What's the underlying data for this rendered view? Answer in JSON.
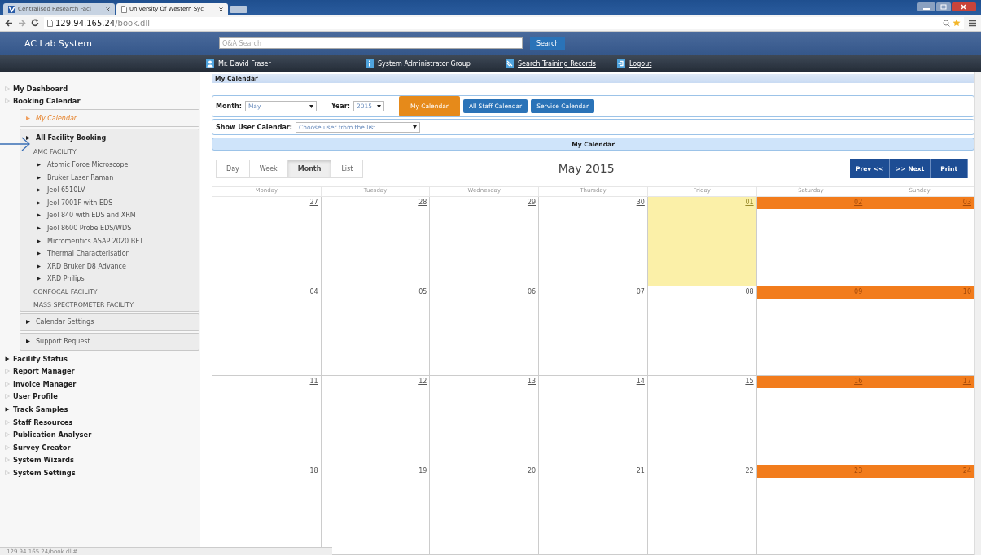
{
  "browser": {
    "tabs": [
      {
        "title": "Centralised Research Faci",
        "selected": false
      },
      {
        "title": "University Of Western Syc",
        "selected": true
      }
    ],
    "address": {
      "host": "129.94.165.24",
      "path": "/book.dll"
    }
  },
  "app": {
    "title": "AC Lab System",
    "search": {
      "placeholder": "Q&A Search",
      "button": "Search"
    }
  },
  "user_bar": [
    {
      "label": "Mr. David Fraser",
      "link": false
    },
    {
      "label": "System Administrator Group",
      "link": false
    },
    {
      "label": "Search Training Records",
      "link": true
    },
    {
      "label": "Logout",
      "link": true
    }
  ],
  "sidebar": [
    {
      "label": "My Dashboard",
      "kind": "page"
    },
    {
      "label": "Booking Calendar",
      "kind": "page",
      "children": [
        {
          "label": "My Calendar",
          "selected": true
        },
        {
          "label": "All Facility Booking",
          "selected": false,
          "children": [
            {
              "label": "AMC FACILITY",
              "children": [
                {
                  "label": "Atomic Force Microscope"
                },
                {
                  "label": "Bruker Laser Raman"
                },
                {
                  "label": "Jeol 6510LV"
                },
                {
                  "label": "Jeol 7001F with EDS"
                },
                {
                  "label": "Jeol 840 with EDS and XRM"
                },
                {
                  "label": "Jeol 8600 Probe EDS/WDS"
                },
                {
                  "label": "Micromeritics ASAP 2020 BET"
                },
                {
                  "label": "Thermal Characterisation"
                },
                {
                  "label": "XRD Bruker D8 Advance"
                },
                {
                  "label": "XRD Philips"
                }
              ]
            },
            {
              "label": "CONFOCAL FACILITY"
            },
            {
              "label": "MASS SPECTROMETER FACILITY"
            }
          ]
        },
        {
          "label": "Calendar Settings",
          "selected": false
        },
        {
          "label": "Support Request",
          "selected": false
        }
      ]
    },
    {
      "label": "Facility Status",
      "kind": "folder"
    },
    {
      "label": "Report Manager",
      "kind": "page"
    },
    {
      "label": "Invoice Manager",
      "kind": "page"
    },
    {
      "label": "User Profile",
      "kind": "page"
    },
    {
      "label": "Track Samples",
      "kind": "folder"
    },
    {
      "label": "Staff Resources",
      "kind": "page"
    },
    {
      "label": "Publication Analyser",
      "kind": "page"
    },
    {
      "label": "Survey Creator",
      "kind": "page"
    },
    {
      "label": "System Wizards",
      "kind": "page"
    },
    {
      "label": "System Settings",
      "kind": "page"
    }
  ],
  "main": {
    "title": "My Calendar",
    "month": {
      "label": "Month:",
      "value": "May"
    },
    "year": {
      "label": "Year:",
      "value": "2015"
    },
    "calendar_buttons": [
      {
        "label": "My Calendar",
        "selected": true
      },
      {
        "label": "All Staff Calendar",
        "selected": false
      },
      {
        "label": "Service Calendar",
        "selected": false
      }
    ],
    "user_calendar": {
      "label": "Show User Calendar:",
      "value": "Choose user from the list"
    },
    "banner": "My Calendar",
    "views": [
      {
        "label": "Day",
        "selected": false
      },
      {
        "label": "Week",
        "selected": false
      },
      {
        "label": "Month",
        "selected": true
      },
      {
        "label": "List",
        "selected": false
      }
    ],
    "heading": "May 2015",
    "nav_buttons": [
      "Prev <<",
      ">> Next",
      "Print"
    ],
    "weekdays": [
      "Monday",
      "Tuesday",
      "Wednesday",
      "Thursday",
      "Friday",
      "Saturday",
      "Sunday"
    ],
    "weeks": [
      [
        {
          "day": "27",
          "kind": "normal"
        },
        {
          "day": "28",
          "kind": "normal"
        },
        {
          "day": "29",
          "kind": "normal"
        },
        {
          "day": "30",
          "kind": "normal"
        },
        {
          "day": "01",
          "kind": "today"
        },
        {
          "day": "02",
          "kind": "weekend"
        },
        {
          "day": "03",
          "kind": "weekend"
        }
      ],
      [
        {
          "day": "04",
          "kind": "normal"
        },
        {
          "day": "05",
          "kind": "normal"
        },
        {
          "day": "06",
          "kind": "normal"
        },
        {
          "day": "07",
          "kind": "normal"
        },
        {
          "day": "08",
          "kind": "normal"
        },
        {
          "day": "09",
          "kind": "weekend"
        },
        {
          "day": "10",
          "kind": "weekend"
        }
      ],
      [
        {
          "day": "11",
          "kind": "normal"
        },
        {
          "day": "12",
          "kind": "normal"
        },
        {
          "day": "13",
          "kind": "normal"
        },
        {
          "day": "14",
          "kind": "normal"
        },
        {
          "day": "15",
          "kind": "normal"
        },
        {
          "day": "16",
          "kind": "weekend"
        },
        {
          "day": "17",
          "kind": "weekend"
        }
      ],
      [
        {
          "day": "18",
          "kind": "normal"
        },
        {
          "day": "19",
          "kind": "normal"
        },
        {
          "day": "20",
          "kind": "normal"
        },
        {
          "day": "21",
          "kind": "normal"
        },
        {
          "day": "22",
          "kind": "normal"
        },
        {
          "day": "23",
          "kind": "weekend"
        },
        {
          "day": "24",
          "kind": "weekend"
        }
      ]
    ]
  },
  "status_bar": "129.94.165.24/book.dll#"
}
